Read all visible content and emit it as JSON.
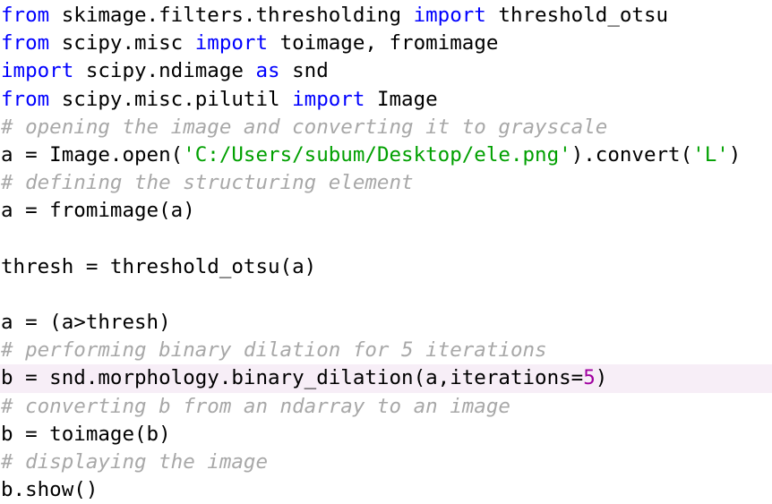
{
  "editor": {
    "colors": {
      "keyword": "#0000ff",
      "string": "#00a000",
      "number": "#a000a0",
      "comment": "#a8a8a8",
      "text": "#000000",
      "current_line_bg": "#f7eef7"
    },
    "current_line_index": 13,
    "lines": [
      {
        "tokens": [
          {
            "t": "kw",
            "v": "from"
          },
          {
            "t": "plain",
            "v": " skimage.filters.thresholding "
          },
          {
            "t": "kw",
            "v": "import"
          },
          {
            "t": "plain",
            "v": " threshold_otsu"
          }
        ]
      },
      {
        "tokens": [
          {
            "t": "kw",
            "v": "from"
          },
          {
            "t": "plain",
            "v": " scipy.misc "
          },
          {
            "t": "kw",
            "v": "import"
          },
          {
            "t": "plain",
            "v": " toimage, fromimage"
          }
        ]
      },
      {
        "tokens": [
          {
            "t": "kw",
            "v": "import"
          },
          {
            "t": "plain",
            "v": " scipy.ndimage "
          },
          {
            "t": "kw",
            "v": "as"
          },
          {
            "t": "plain",
            "v": " snd"
          }
        ]
      },
      {
        "tokens": [
          {
            "t": "kw",
            "v": "from"
          },
          {
            "t": "plain",
            "v": " scipy.misc.pilutil "
          },
          {
            "t": "kw",
            "v": "import"
          },
          {
            "t": "plain",
            "v": " Image"
          }
        ]
      },
      {
        "tokens": [
          {
            "t": "cmt",
            "v": "# opening the image and converting it to grayscale"
          }
        ]
      },
      {
        "tokens": [
          {
            "t": "plain",
            "v": "a = Image.open("
          },
          {
            "t": "str",
            "v": "'C:/Users/subum/Desktop/ele.png'"
          },
          {
            "t": "plain",
            "v": ").convert("
          },
          {
            "t": "str",
            "v": "'L'"
          },
          {
            "t": "plain",
            "v": ")"
          }
        ]
      },
      {
        "tokens": [
          {
            "t": "cmt",
            "v": "# defining the structuring element"
          }
        ]
      },
      {
        "tokens": [
          {
            "t": "plain",
            "v": "a = fromimage(a)"
          }
        ]
      },
      {
        "tokens": []
      },
      {
        "tokens": [
          {
            "t": "plain",
            "v": "thresh = threshold_otsu(a)"
          }
        ]
      },
      {
        "tokens": []
      },
      {
        "tokens": [
          {
            "t": "plain",
            "v": "a = (a>thresh)"
          }
        ]
      },
      {
        "tokens": [
          {
            "t": "cmt",
            "v": "# performing binary dilation for 5 iterations"
          }
        ]
      },
      {
        "tokens": [
          {
            "t": "plain",
            "v": "b = snd.morphology.binary_dilation(a,iterations="
          },
          {
            "t": "num",
            "v": "5"
          },
          {
            "t": "plain",
            "v": ")"
          }
        ]
      },
      {
        "tokens": [
          {
            "t": "cmt",
            "v": "# converting b from an ndarray to an image"
          }
        ]
      },
      {
        "tokens": [
          {
            "t": "plain",
            "v": "b = toimage(b)"
          }
        ]
      },
      {
        "tokens": [
          {
            "t": "cmt",
            "v": "# displaying the image"
          }
        ]
      },
      {
        "tokens": [
          {
            "t": "plain",
            "v": "b.show()"
          }
        ]
      }
    ]
  }
}
